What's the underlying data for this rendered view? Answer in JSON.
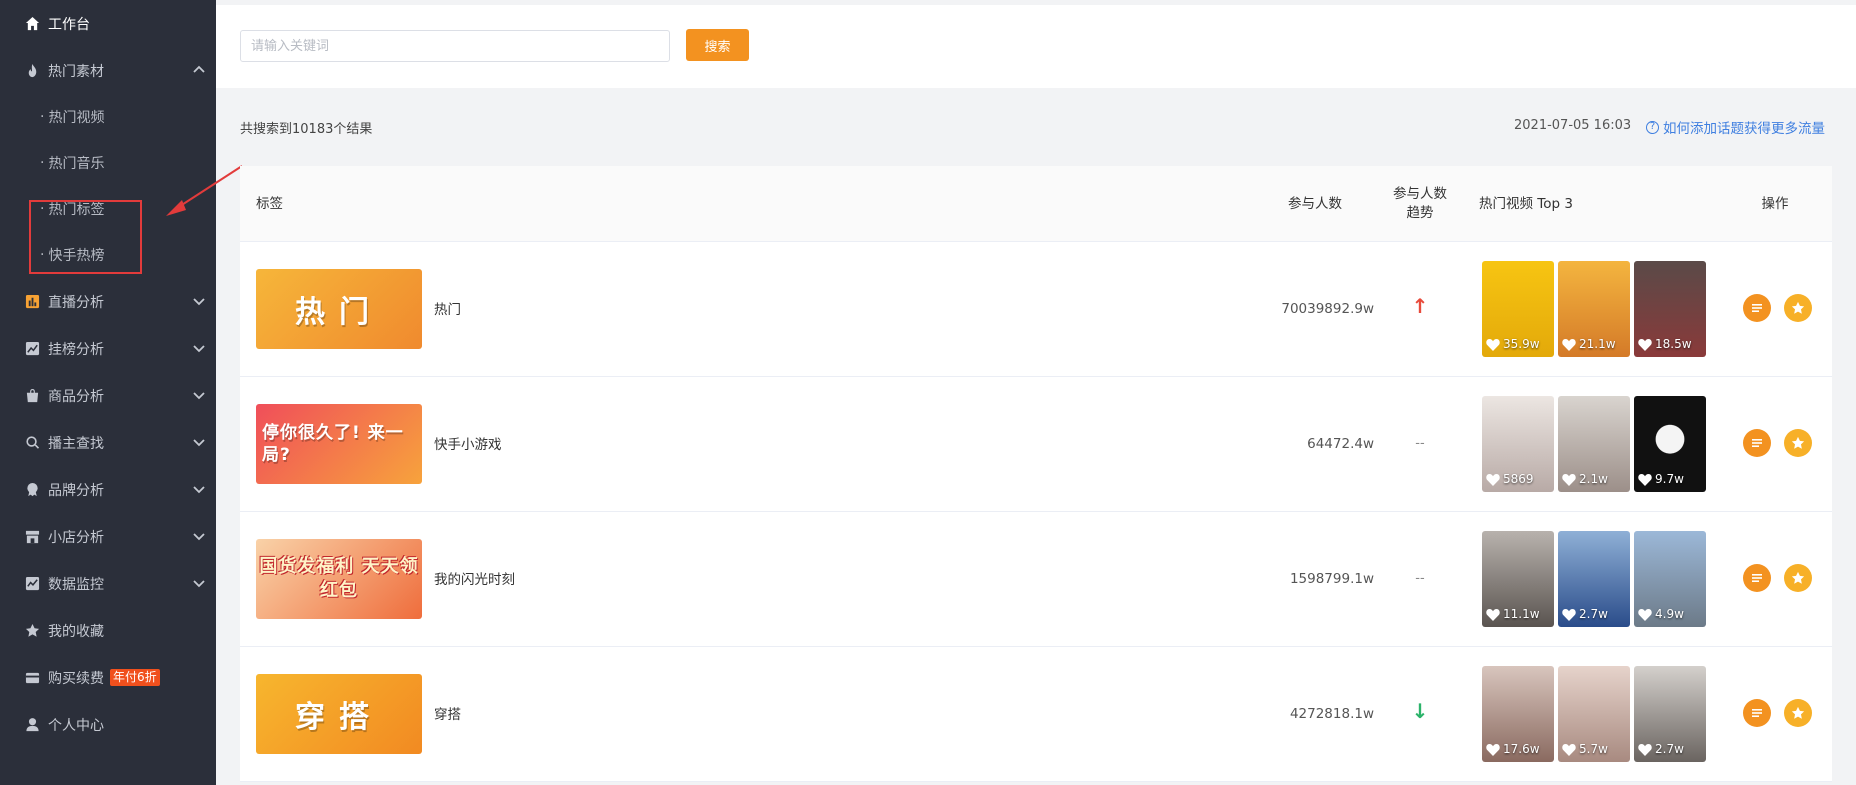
{
  "sidebar": {
    "workbench": "工作台",
    "hot_material": "热门素材",
    "sub_items": [
      "热门视频",
      "热门音乐",
      "热门标签",
      "快手热榜"
    ],
    "live_analysis": "直播分析",
    "rank_analysis": "挂榜分析",
    "product_analysis": "商品分析",
    "anchor_search": "播主查找",
    "brand_analysis": "品牌分析",
    "shop_analysis": "小店分析",
    "data_monitor": "数据监控",
    "favorites": "我的收藏",
    "purchase": "购买续费",
    "purchase_badge": "年付6折",
    "personal_center": "个人中心"
  },
  "search": {
    "placeholder": "请输入关键词",
    "button_label": "搜索"
  },
  "results": {
    "summary": "共搜索到10183个结果",
    "date": "2021-07-05 16:03",
    "help_link": "如何添加话题获得更多流量"
  },
  "table": {
    "headers": {
      "tag": "标签",
      "participants": "参与人数",
      "trend_line1": "参与人数",
      "trend_line2": "趋势",
      "top_videos": "热门视频 Top 3",
      "actions": "操作"
    },
    "rows": [
      {
        "thumb_text": "热门",
        "name": "热门",
        "count": "70039892.9w",
        "trend": "↑",
        "trend_dir": "up",
        "videos": [
          "35.9w",
          "21.1w",
          "18.5w"
        ]
      },
      {
        "thumb_text": "停你很久了! 来一局?",
        "name": "快手小游戏",
        "count": "64472.4w",
        "trend": "--",
        "trend_dir": "flat",
        "videos": [
          "5869",
          "2.1w",
          "9.7w"
        ]
      },
      {
        "thumb_text": "国货发福利 天天领红包",
        "name": "我的闪光时刻",
        "count": "1598799.1w",
        "trend": "--",
        "trend_dir": "flat",
        "videos": [
          "11.1w",
          "2.7w",
          "4.9w"
        ]
      },
      {
        "thumb_text": "穿搭",
        "name": "穿搭",
        "count": "4272818.1w",
        "trend": "↓",
        "trend_dir": "down",
        "videos": [
          "17.6w",
          "5.7w",
          "2.7w"
        ]
      }
    ]
  },
  "colors": {
    "sidebar_bg": "#2b2f3a",
    "accent_orange": "#f39220",
    "link_blue": "#3f7fe0",
    "trend_up": "#e84a3b",
    "trend_down": "#2bb36a",
    "annotation_red": "#e23b3b"
  },
  "icons": [
    "home-icon",
    "fire-icon",
    "bar-chart-icon",
    "line-chart-icon",
    "bag-icon",
    "search-icon",
    "brand-icon",
    "store-icon",
    "monitor-icon",
    "star-icon",
    "wallet-icon",
    "user-icon",
    "chevron-icon",
    "heart-icon",
    "list-icon"
  ]
}
